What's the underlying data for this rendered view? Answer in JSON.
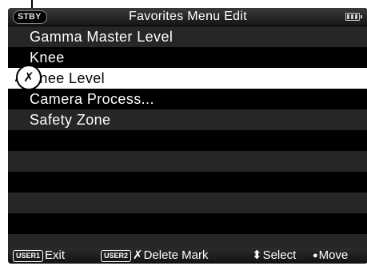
{
  "header": {
    "status": "STBY",
    "title": "Favorites Menu Edit"
  },
  "menu": {
    "items": [
      {
        "label": "Gamma Master Level"
      },
      {
        "label": "Knee"
      },
      {
        "label": "Knee Level"
      },
      {
        "label": "Camera Process..."
      },
      {
        "label": "Safety Zone"
      }
    ],
    "selected_mark": "✗"
  },
  "footer": {
    "exit": {
      "key": "USER1",
      "label": "Exit"
    },
    "delete_mark": {
      "key": "USER2",
      "icon": "✗",
      "label": "Delete Mark"
    },
    "select": {
      "icon": "⬍",
      "label": "Select"
    },
    "move": {
      "icon": "●",
      "label": "Move"
    }
  },
  "callout": {
    "mark": "✗"
  },
  "colors": {
    "screen_bg": "#000000",
    "row_alt": "#262626",
    "selected_row": "#ffffff"
  }
}
